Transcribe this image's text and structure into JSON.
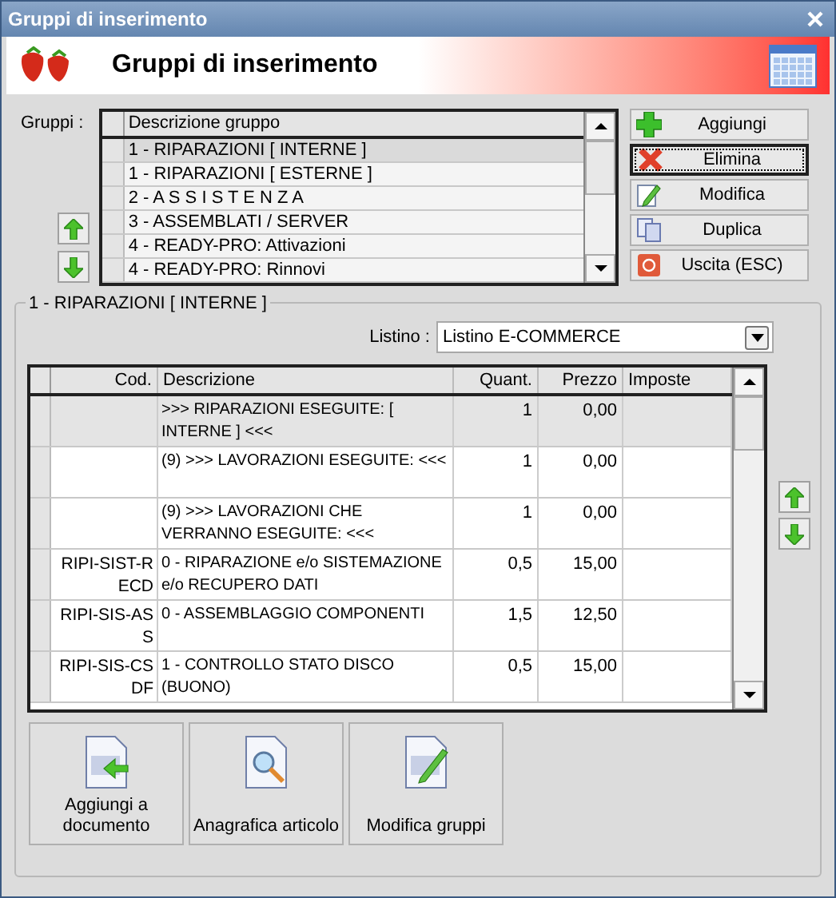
{
  "window": {
    "title": "Gruppi di inserimento"
  },
  "header": {
    "title": "Gruppi di inserimento"
  },
  "groups": {
    "label": "Gruppi :",
    "column": "Descrizione gruppo",
    "rows": [
      {
        "text": "1 - RIPARAZIONI [ INTERNE ]",
        "selected": true
      },
      {
        "text": "1 - RIPARAZIONI [ ESTERNE ]",
        "selected": false
      },
      {
        "text": "2 - A S S I S T E N Z A",
        "selected": false
      },
      {
        "text": "3 - ASSEMBLATI / SERVER",
        "selected": false
      },
      {
        "text": "4 - READY-PRO: Attivazioni",
        "selected": false
      },
      {
        "text": "4 - READY-PRO: Rinnovi",
        "selected": false
      }
    ]
  },
  "actions": [
    {
      "label": "Aggiungi",
      "kind": "add",
      "focused": false
    },
    {
      "label": "Elimina",
      "kind": "delete",
      "focused": true
    },
    {
      "label": "Modifica",
      "kind": "edit",
      "focused": false
    },
    {
      "label": "Duplica",
      "kind": "copy",
      "focused": false
    },
    {
      "label": "Uscita (ESC)",
      "kind": "exit",
      "focused": false
    }
  ],
  "group_box": {
    "title": "1 - RIPARAZIONI [ INTERNE ]"
  },
  "listino": {
    "label": "Listino :",
    "value": "Listino E-COMMERCE"
  },
  "items": {
    "columns": [
      "Cod.",
      "Descrizione",
      "Quant.",
      "Prezzo",
      "Imposte"
    ],
    "rows": [
      {
        "cod": "",
        "desc": ">>> RIPARAZIONI ESEGUITE: [ INTERNE ] <<<",
        "qty": "1",
        "price": "0,00",
        "selected": true
      },
      {
        "cod": "",
        "desc": "(9) >>> LAVORAZIONI ESEGUITE: <<<",
        "qty": "1",
        "price": "0,00",
        "selected": false
      },
      {
        "cod": "",
        "desc": "(9) >>> LAVORAZIONI CHE VERRANNO ESEGUITE: <<<",
        "qty": "1",
        "price": "0,00",
        "selected": false
      },
      {
        "cod": "RIPI-SIST-RECD",
        "desc": "0 - RIPARAZIONE e/o SISTEMAZIONE e/o RECUPERO DATI",
        "qty": "0,5",
        "price": "15,00",
        "selected": false
      },
      {
        "cod": "RIPI-SIS-ASS",
        "desc": "0 - ASSEMBLAGGIO COMPONENTI",
        "qty": "1,5",
        "price": "12,50",
        "selected": false
      },
      {
        "cod": "RIPI-SIS-CSDF",
        "desc": "1 - CONTROLLO STATO DISCO (BUONO)",
        "qty": "0,5",
        "price": "15,00",
        "selected": false
      }
    ]
  },
  "bottom_buttons": [
    {
      "label": "Aggiungi a documento",
      "kind": "add-doc"
    },
    {
      "label": "Anagrafica articolo",
      "kind": "search-doc"
    },
    {
      "label": "Modifica gruppi",
      "kind": "edit-doc"
    }
  ]
}
